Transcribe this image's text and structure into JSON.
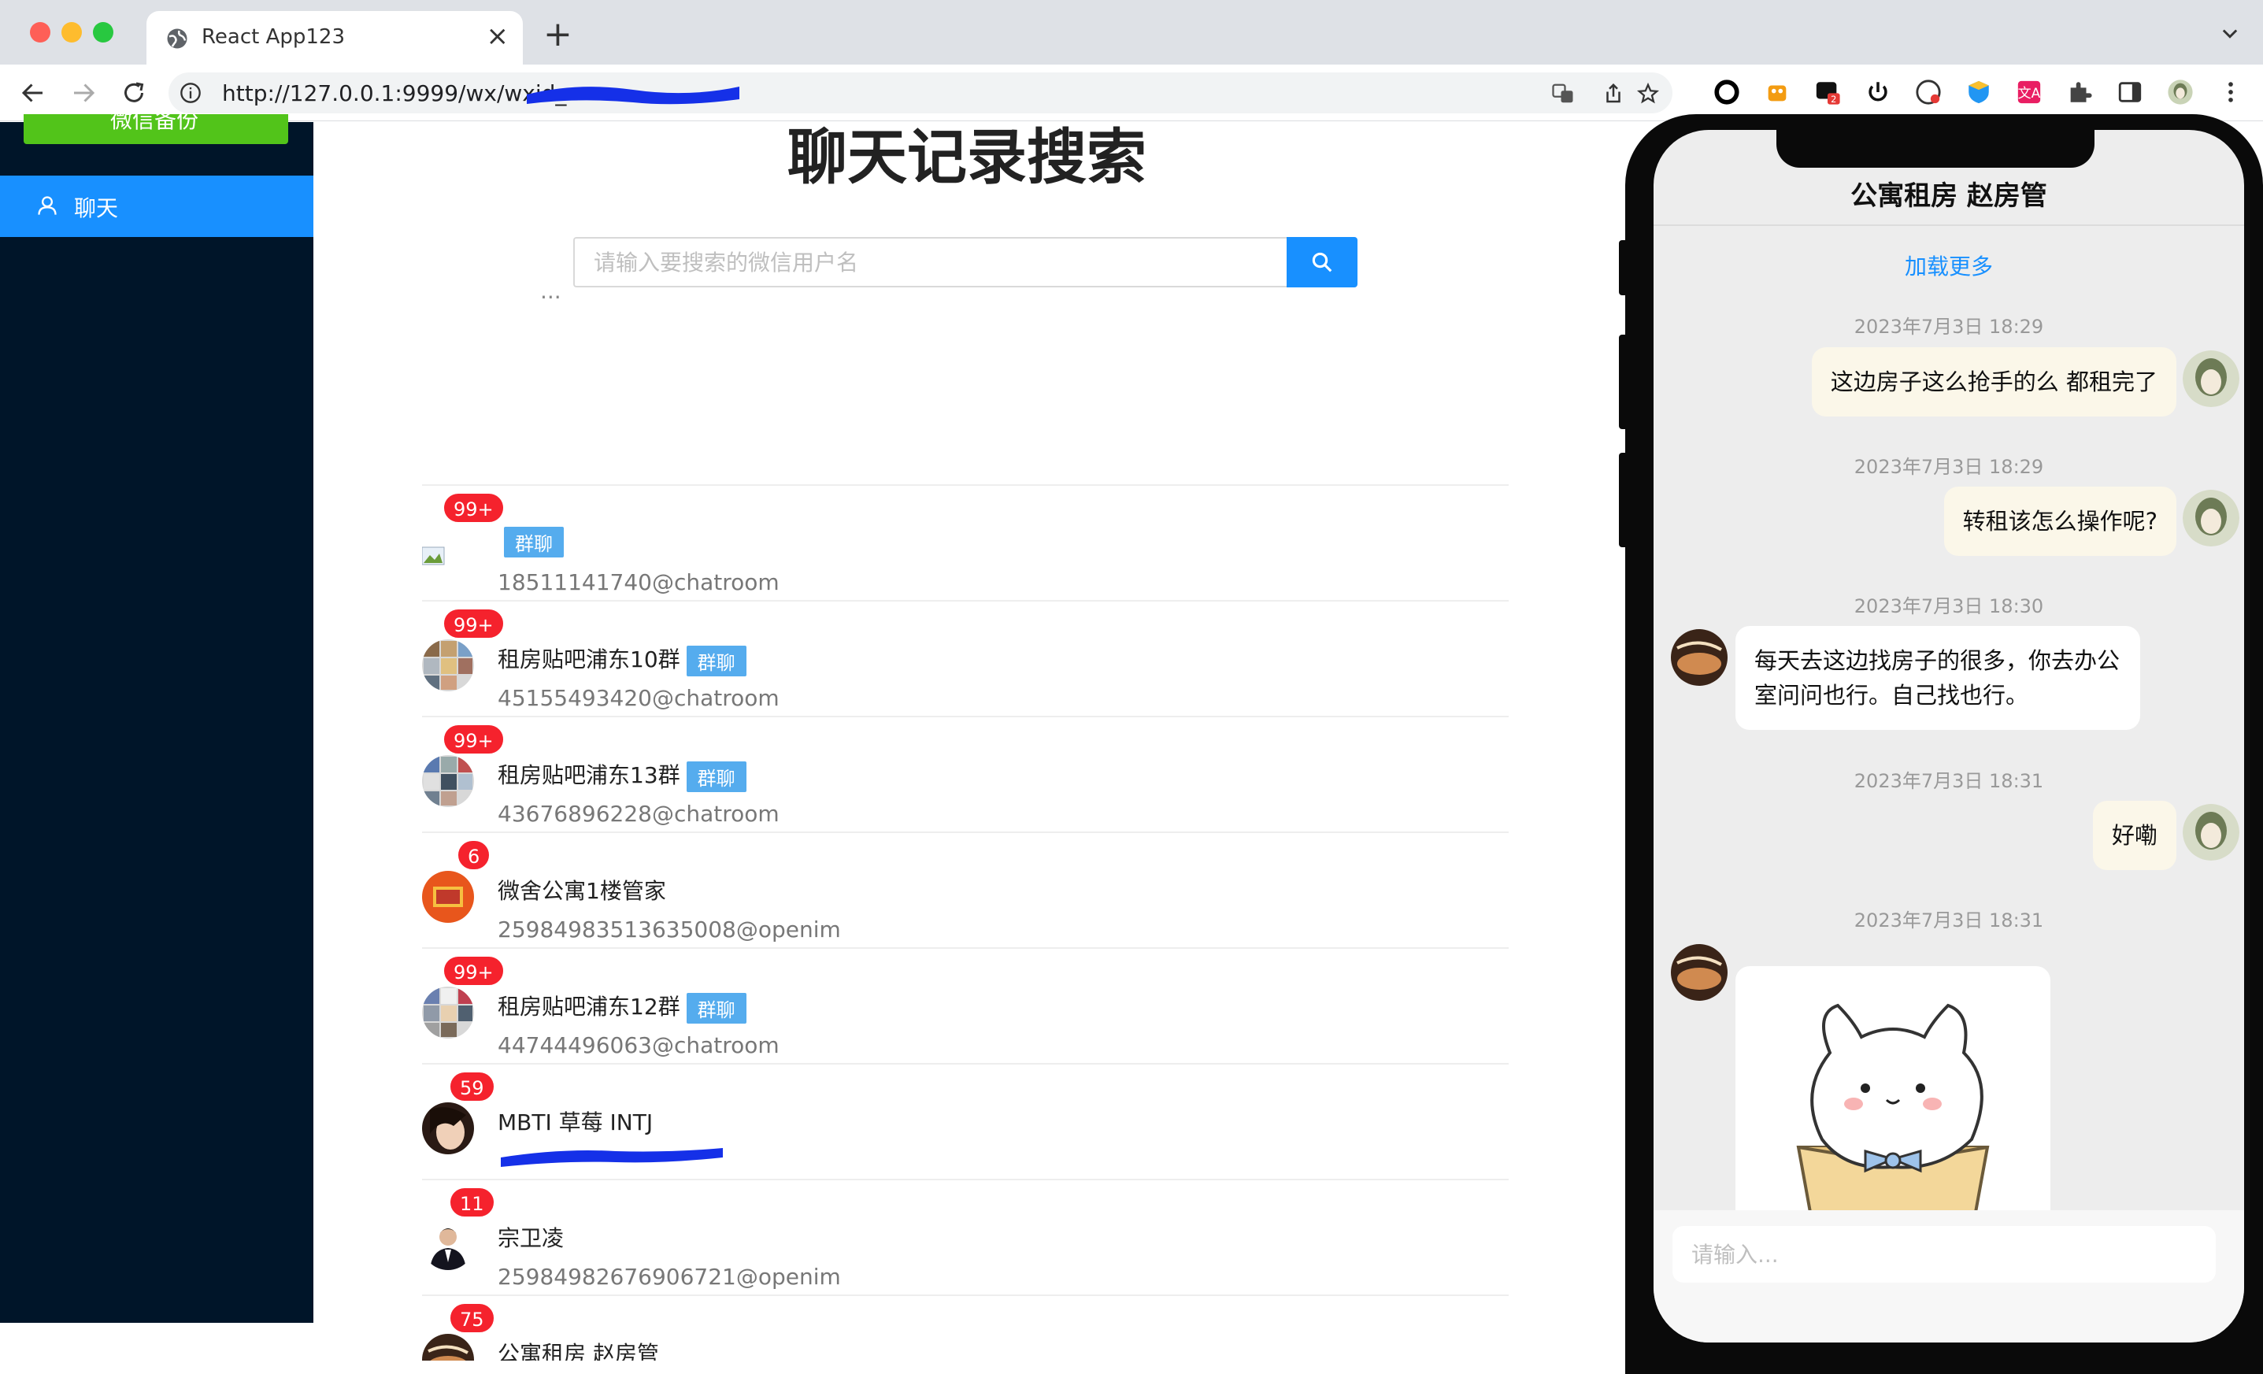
{
  "browser": {
    "tab_title": "React App123",
    "tab_close": "×",
    "new_tab": "+",
    "url_visible": "http://127.0.0.1:9999/wx/wxid_"
  },
  "sidebar": {
    "top_button_label": "微信备份",
    "items": [
      {
        "label": "聊天",
        "active": true
      }
    ]
  },
  "main": {
    "title": "聊天记录搜索",
    "search": {
      "placeholder": "请输入要搜索的微信用户名"
    },
    "conversations": [
      {
        "badge": "99+",
        "name": "",
        "is_group": true,
        "group_tag": "群聊",
        "sub": "18511141740@chatroom"
      },
      {
        "badge": "99+",
        "name": "租房贴吧浦东10群",
        "is_group": true,
        "group_tag": "群聊",
        "sub": "45155493420@chatroom"
      },
      {
        "badge": "99+",
        "name": "租房贴吧浦东13群",
        "is_group": true,
        "group_tag": "群聊",
        "sub": "43676896228@chatroom"
      },
      {
        "badge": "6",
        "name": "微舍公寓1楼管家",
        "is_group": false,
        "group_tag": "",
        "sub": "25984983513635008@openim"
      },
      {
        "badge": "99+",
        "name": "租房贴吧浦东12群",
        "is_group": true,
        "group_tag": "群聊",
        "sub": "44744496063@chatroom"
      },
      {
        "badge": "59",
        "name": "MBTI 草莓 INTJ",
        "is_group": false,
        "group_tag": "",
        "sub": "",
        "sub_redacted": true
      },
      {
        "badge": "11",
        "name": "宗卫凌",
        "is_group": false,
        "group_tag": "",
        "sub": "25984982676906721@openim"
      },
      {
        "badge": "75",
        "name": "公寓租房 赵房管",
        "is_group": false,
        "group_tag": "",
        "sub": "",
        "sub_redacted": true
      }
    ]
  },
  "chat": {
    "title": "公寓租房 赵房管",
    "load_more": "加载更多",
    "messages": [
      {
        "time": "2023年7月3日 18:29",
        "from": "self",
        "text": "这边房子这么抢手的么 都租完了"
      },
      {
        "time": "2023年7月3日 18:29",
        "from": "self",
        "text": "转租该怎么操作呢?"
      },
      {
        "time": "2023年7月3日 18:30",
        "from": "other",
        "text": "每天去这边找房子的很多，你去办公室问问也行。自己找也行。"
      },
      {
        "time": "2023年7月3日 18:31",
        "from": "self",
        "text": "好嘞"
      },
      {
        "time": "2023年7月3日 18:31",
        "from": "other",
        "text": "",
        "type": "sticker"
      }
    ],
    "input_placeholder": "请输入..."
  },
  "colors": {
    "sidebar_bg": "#001529",
    "accent": "#1890ff",
    "badge": "#f5222d",
    "group_tag": "#55acee",
    "self_bubble": "#fbf7e9"
  }
}
